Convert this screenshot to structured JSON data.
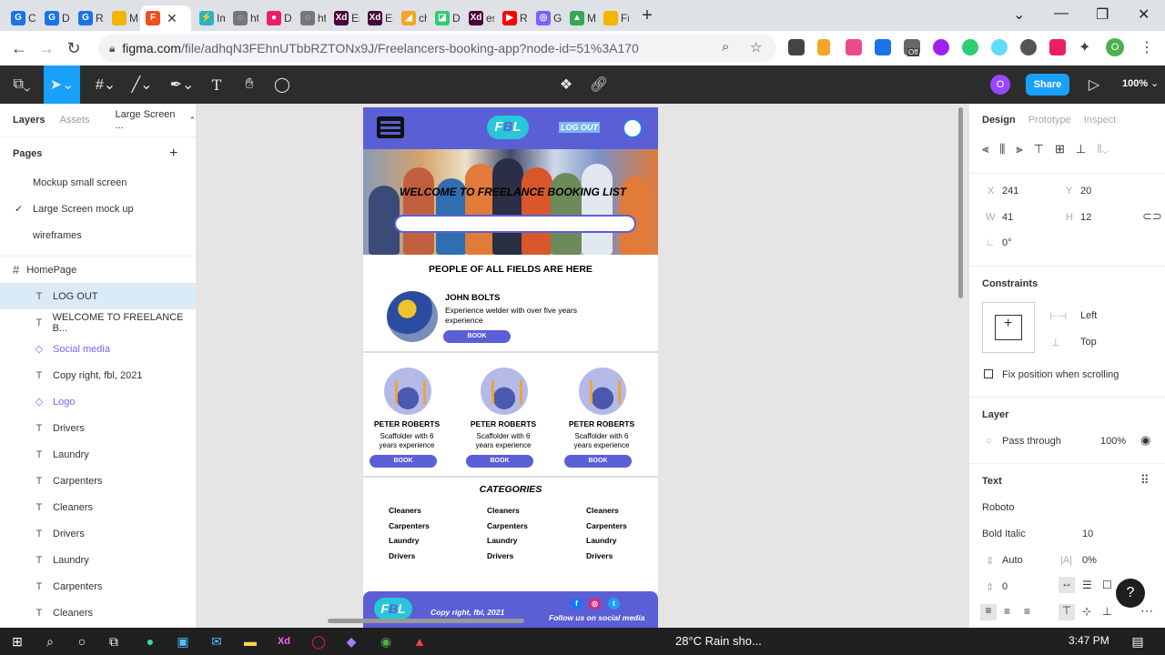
{
  "browser": {
    "tabs": [
      {
        "label": "Co",
        "color": "#1a73e8",
        "glyph": "G"
      },
      {
        "label": "De",
        "color": "#1a73e8",
        "glyph": "G"
      },
      {
        "label": "Re",
        "color": "#1a73e8",
        "glyph": "G"
      },
      {
        "label": "Me",
        "color": "#f4b400",
        "glyph": ""
      },
      {
        "label": "",
        "color": "#f24e1e",
        "glyph": "F",
        "active": true
      },
      {
        "label": "Im",
        "color": "#2bb3c0",
        "glyph": "⚡"
      },
      {
        "label": "htt",
        "color": "#777777",
        "glyph": "◌"
      },
      {
        "label": "De",
        "color": "#e91e63",
        "glyph": "●"
      },
      {
        "label": "htt",
        "color": "#777777",
        "glyph": "◌"
      },
      {
        "label": "Est",
        "color": "#470137",
        "glyph": "Xd"
      },
      {
        "label": "EST",
        "color": "#470137",
        "glyph": "Xd"
      },
      {
        "label": "cha",
        "color": "#f5a623",
        "glyph": "◢"
      },
      {
        "label": "Da",
        "color": "#2ecc71",
        "glyph": "◪"
      },
      {
        "label": "est",
        "color": "#470137",
        "glyph": "Xd"
      },
      {
        "label": "Re",
        "color": "#ff0000",
        "glyph": "▶"
      },
      {
        "label": "Ge",
        "color": "#7b61ff",
        "glyph": "◎"
      },
      {
        "label": "My",
        "color": "#34a853",
        "glyph": "▲"
      },
      {
        "label": "Fre",
        "color": "#f4b400",
        "glyph": ""
      }
    ],
    "url_domain": "figma.com",
    "url_path": "/file/adhqN3FEhnUTbbRZTONx9J/Freelancers-booking-app?node-id=51%3A170",
    "ext_badge": "Off",
    "profile_initial": "O"
  },
  "figma": {
    "avatar_initial": "O",
    "share_label": "Share",
    "zoom": "100%",
    "left": {
      "tab_layers": "Layers",
      "tab_assets": "Assets",
      "current_page": "Large Screen ...",
      "pages_title": "Pages",
      "pages": [
        "Mockup small screen",
        "Large Screen mock up",
        "wireframes"
      ],
      "frame_name": "HomePage",
      "layers": [
        {
          "icon": "T",
          "name": "LOG OUT",
          "selected": true
        },
        {
          "icon": "T",
          "name": "WELCOME TO FREELANCE B..."
        },
        {
          "icon": "◇",
          "name": "Social media",
          "component": true
        },
        {
          "icon": "T",
          "name": "Copy right, fbl, 2021"
        },
        {
          "icon": "◇",
          "name": "Logo",
          "component": true
        },
        {
          "icon": "T",
          "name": "Drivers"
        },
        {
          "icon": "T",
          "name": "Laundry"
        },
        {
          "icon": "T",
          "name": "Carpenters"
        },
        {
          "icon": "T",
          "name": "Cleaners"
        },
        {
          "icon": "T",
          "name": "Drivers"
        },
        {
          "icon": "T",
          "name": "Laundry"
        },
        {
          "icon": "T",
          "name": "Carpenters"
        },
        {
          "icon": "T",
          "name": "Cleaners"
        }
      ]
    },
    "right": {
      "tab_design": "Design",
      "tab_prototype": "Prototype",
      "tab_inspect": "Inspect",
      "x_label": "X",
      "x": "241",
      "y_label": "Y",
      "y": "20",
      "w_label": "W",
      "w": "41",
      "h_label": "H",
      "h": "12",
      "rotation": "0°",
      "constraints_title": "Constraints",
      "constraint_h": "Left",
      "constraint_v": "Top",
      "fix_position": "Fix position when scrolling",
      "layer_title": "Layer",
      "blend": "Pass through",
      "opacity": "100%",
      "text_title": "Text",
      "font": "Roboto",
      "weight": "Bold Italic",
      "size": "10",
      "line_height": "Auto",
      "letter_spacing": "0%",
      "paragraph": "0"
    },
    "design": {
      "logo_text_a": "F",
      "logo_text_b": "B",
      "logo_text_c": "L",
      "logout": "LOG OUT",
      "hero_title": "WELCOME TO FREELANCE BOOKING LIST",
      "subtitle": "PEOPLE OF ALL FIELDS ARE HERE",
      "featured": {
        "name": "JOHN BOLTS",
        "desc": "Experience welder with over five years experience",
        "book": "BOOK"
      },
      "cards": [
        {
          "name": "PETER ROBERTS",
          "desc": "Scaffolder with 6 years experience",
          "book": "BOOK"
        },
        {
          "name": "PETER ROBERTS",
          "desc": "Scaffolder with 6 years experience",
          "book": "BOOK"
        },
        {
          "name": "PETER ROBERTS",
          "desc": "Scaffolder with 6 years experience",
          "book": "BOOK"
        }
      ],
      "categories_title": "CATEGORIES",
      "categories": [
        "Cleaners",
        "Carpenters",
        "Laundry",
        "Drivers"
      ],
      "copyright": "Copy right, fbl, 2021",
      "follow": "Follow us on social media"
    }
  },
  "taskbar": {
    "weather": "28°C  Rain sho...",
    "time": "3:47 PM"
  }
}
